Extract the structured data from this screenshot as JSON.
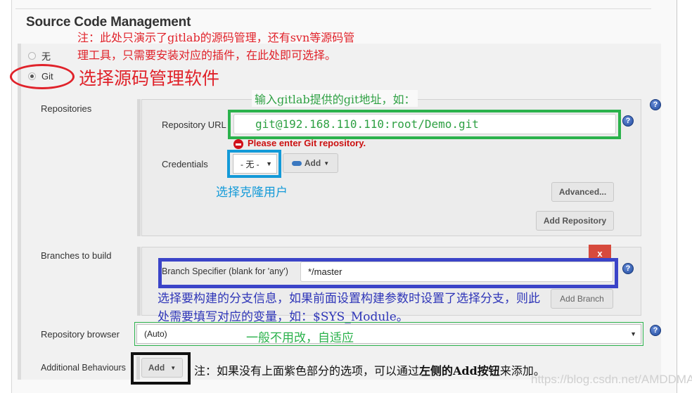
{
  "section": {
    "title": "Source Code Management"
  },
  "scm_options": [
    {
      "label": "无",
      "selected": false
    },
    {
      "label": "Git",
      "selected": true
    }
  ],
  "annotations": {
    "note_scm_line1": "注：此处只演示了gitlab的源码管理，还有svn等源码管",
    "note_scm_line2": "理工具，只需要安装对应的插件，在此处即可选择。",
    "choose_scm": "选择源码管理软件",
    "enter_url": "输入gitlab提供的git地址，如：",
    "choose_clone_user": "选择克隆用户",
    "branch_line1": "选择要构建的分支信息，如果前面设置构建参数时设置了选择分支，则此",
    "branch_line2": "处需要填写对应的变量，如：$SYS_Module。",
    "browser_note": "一般不用改，自适应",
    "add_note_pre": "注：如果没有上面紫色部分的选项，可以通过",
    "add_note_bold": "左侧的Add按钮",
    "add_note_post": "来添加。"
  },
  "repositories": {
    "label": "Repositories",
    "url_label": "Repository URL",
    "url_value": "git@192.168.110.110:root/Demo.git",
    "error": "Please enter Git repository.",
    "credentials_label": "Credentials",
    "credentials_value": "- 无 -",
    "add_label": "Add",
    "advanced_label": "Advanced...",
    "add_repository_label": "Add Repository"
  },
  "branches": {
    "label": "Branches to build",
    "specifier_label": "Branch Specifier (blank for 'any')",
    "specifier_value": "*/master",
    "delete_label": "x",
    "add_branch_label": "Add Branch"
  },
  "repository_browser": {
    "label": "Repository browser",
    "value": "(Auto)"
  },
  "additional_behaviours": {
    "label": "Additional Behaviours",
    "add_label": "Add"
  },
  "watermark": "https://blog.csdn.net/AMDDMA",
  "colors": {
    "annotation_red": "#e0222a",
    "annotation_green": "#2ea043",
    "annotation_cyan": "#139ad8",
    "annotation_blue": "#2e35b8",
    "frame_blue": "#3b44c8"
  }
}
